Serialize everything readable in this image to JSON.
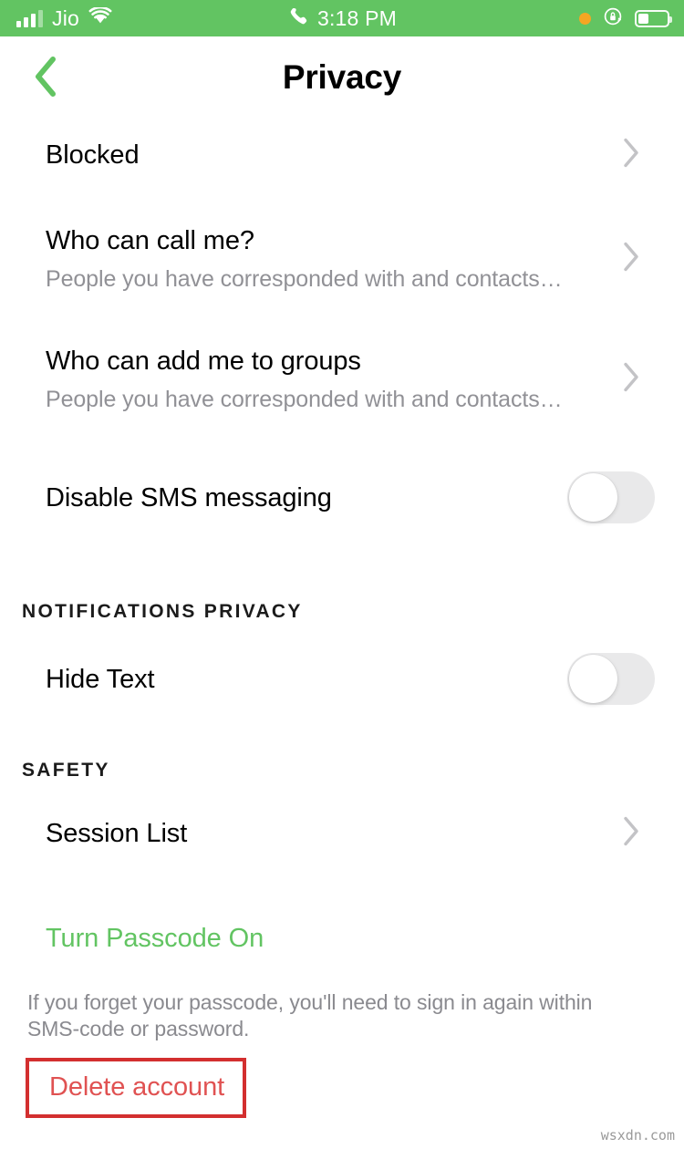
{
  "status_bar": {
    "carrier": "Jio",
    "time": "3:18 PM",
    "signal_icon": "signal-bars-icon",
    "wifi_icon": "wifi-icon",
    "call_icon": "phone-call-icon",
    "recording_icon": "recording-dot-icon",
    "rotation_lock_icon": "rotation-lock-icon",
    "battery_icon": "battery-icon",
    "background_color": "#62c462",
    "battery_level_percent": 30,
    "signal_bars_filled": 3,
    "signal_bars_total": 4
  },
  "nav": {
    "title": "Privacy",
    "back_icon": "chevron-left-icon",
    "back_color": "#62c462"
  },
  "rows": [
    {
      "title": "Blocked",
      "subtitle": "",
      "accessory": "chevron"
    },
    {
      "title": "Who can call me?",
      "subtitle": "People you have corresponded with and contacts…",
      "accessory": "chevron"
    },
    {
      "title": "Who can add me to groups",
      "subtitle": "People you have corresponded with and contacts…",
      "accessory": "chevron"
    },
    {
      "title": "Disable SMS messaging",
      "subtitle": "",
      "accessory": "toggle",
      "toggle_on": false
    }
  ],
  "sections": [
    {
      "header": "NOTIFICATIONS PRIVACY",
      "rows": [
        {
          "title": "Hide Text",
          "subtitle": "",
          "accessory": "toggle",
          "toggle_on": false
        }
      ]
    },
    {
      "header": "SAFETY",
      "rows": [
        {
          "title": "Session List",
          "subtitle": "",
          "accessory": "chevron"
        }
      ]
    }
  ],
  "passcode": {
    "link_label": "Turn Passcode On",
    "link_color": "#62c462",
    "note": "If you forget your passcode, you'll need to sign in again within SMS-code or password."
  },
  "delete": {
    "label": "Delete account",
    "text_color": "#e05252",
    "highlight_border_color": "#d32f2f"
  },
  "watermark": "wsxdn.com"
}
